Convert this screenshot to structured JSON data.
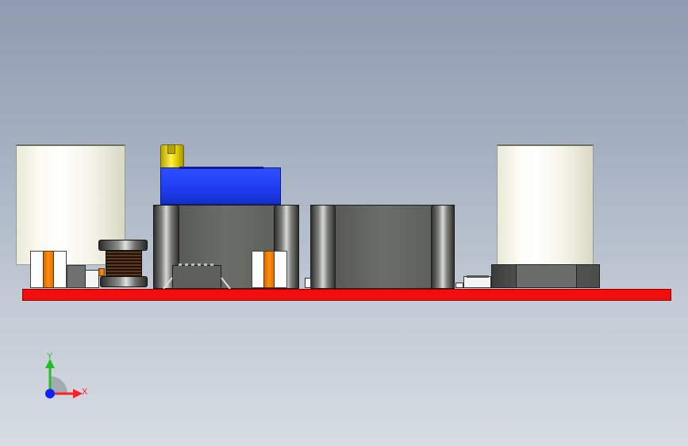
{
  "viewport": {
    "title": "",
    "background_gradient": [
      "#8e9bb0",
      "#d7dce3"
    ]
  },
  "model": {
    "pcb_color": "#f20d0d",
    "capacitor_color": "#fbfbf2",
    "trimmer_color": "#1f3bf0",
    "trimmer_screw_color": "#fff14a",
    "terminal_color": "#ff8c12"
  },
  "triad": {
    "x_label": "X",
    "y_label": "Y",
    "x_color": "#ff2020",
    "y_color": "#20c020",
    "z_color": "#1020ff"
  }
}
